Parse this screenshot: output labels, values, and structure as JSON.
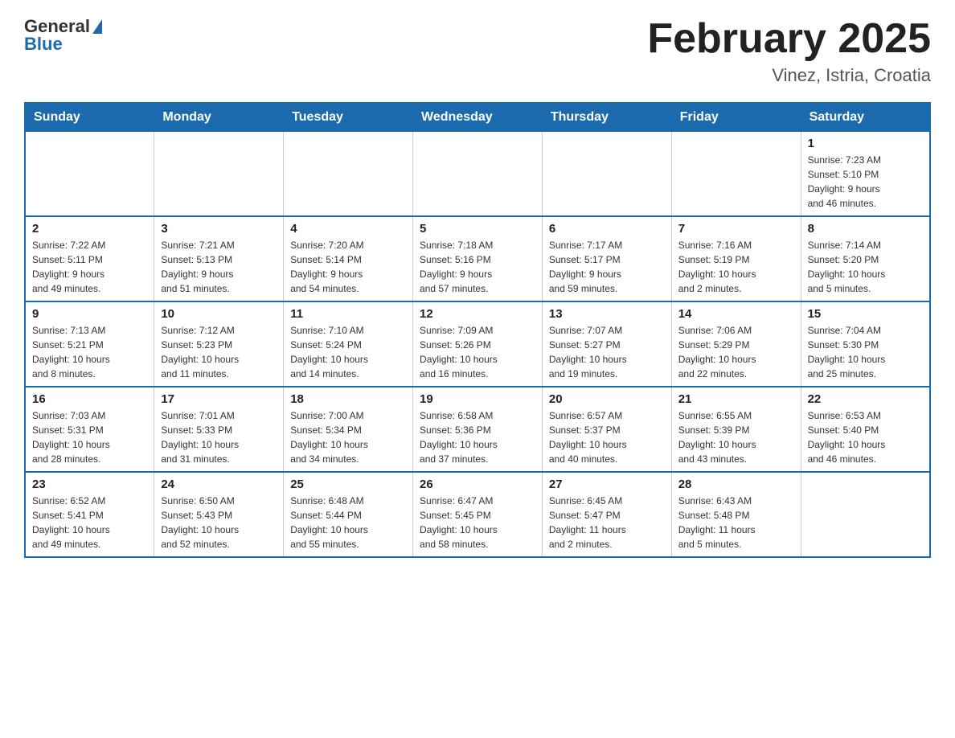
{
  "logo": {
    "general": "General",
    "blue": "Blue"
  },
  "header": {
    "month": "February 2025",
    "location": "Vinez, Istria, Croatia"
  },
  "days_of_week": [
    "Sunday",
    "Monday",
    "Tuesday",
    "Wednesday",
    "Thursday",
    "Friday",
    "Saturday"
  ],
  "weeks": [
    [
      {
        "day": "",
        "info": ""
      },
      {
        "day": "",
        "info": ""
      },
      {
        "day": "",
        "info": ""
      },
      {
        "day": "",
        "info": ""
      },
      {
        "day": "",
        "info": ""
      },
      {
        "day": "",
        "info": ""
      },
      {
        "day": "1",
        "info": "Sunrise: 7:23 AM\nSunset: 5:10 PM\nDaylight: 9 hours\nand 46 minutes."
      }
    ],
    [
      {
        "day": "2",
        "info": "Sunrise: 7:22 AM\nSunset: 5:11 PM\nDaylight: 9 hours\nand 49 minutes."
      },
      {
        "day": "3",
        "info": "Sunrise: 7:21 AM\nSunset: 5:13 PM\nDaylight: 9 hours\nand 51 minutes."
      },
      {
        "day": "4",
        "info": "Sunrise: 7:20 AM\nSunset: 5:14 PM\nDaylight: 9 hours\nand 54 minutes."
      },
      {
        "day": "5",
        "info": "Sunrise: 7:18 AM\nSunset: 5:16 PM\nDaylight: 9 hours\nand 57 minutes."
      },
      {
        "day": "6",
        "info": "Sunrise: 7:17 AM\nSunset: 5:17 PM\nDaylight: 9 hours\nand 59 minutes."
      },
      {
        "day": "7",
        "info": "Sunrise: 7:16 AM\nSunset: 5:19 PM\nDaylight: 10 hours\nand 2 minutes."
      },
      {
        "day": "8",
        "info": "Sunrise: 7:14 AM\nSunset: 5:20 PM\nDaylight: 10 hours\nand 5 minutes."
      }
    ],
    [
      {
        "day": "9",
        "info": "Sunrise: 7:13 AM\nSunset: 5:21 PM\nDaylight: 10 hours\nand 8 minutes."
      },
      {
        "day": "10",
        "info": "Sunrise: 7:12 AM\nSunset: 5:23 PM\nDaylight: 10 hours\nand 11 minutes."
      },
      {
        "day": "11",
        "info": "Sunrise: 7:10 AM\nSunset: 5:24 PM\nDaylight: 10 hours\nand 14 minutes."
      },
      {
        "day": "12",
        "info": "Sunrise: 7:09 AM\nSunset: 5:26 PM\nDaylight: 10 hours\nand 16 minutes."
      },
      {
        "day": "13",
        "info": "Sunrise: 7:07 AM\nSunset: 5:27 PM\nDaylight: 10 hours\nand 19 minutes."
      },
      {
        "day": "14",
        "info": "Sunrise: 7:06 AM\nSunset: 5:29 PM\nDaylight: 10 hours\nand 22 minutes."
      },
      {
        "day": "15",
        "info": "Sunrise: 7:04 AM\nSunset: 5:30 PM\nDaylight: 10 hours\nand 25 minutes."
      }
    ],
    [
      {
        "day": "16",
        "info": "Sunrise: 7:03 AM\nSunset: 5:31 PM\nDaylight: 10 hours\nand 28 minutes."
      },
      {
        "day": "17",
        "info": "Sunrise: 7:01 AM\nSunset: 5:33 PM\nDaylight: 10 hours\nand 31 minutes."
      },
      {
        "day": "18",
        "info": "Sunrise: 7:00 AM\nSunset: 5:34 PM\nDaylight: 10 hours\nand 34 minutes."
      },
      {
        "day": "19",
        "info": "Sunrise: 6:58 AM\nSunset: 5:36 PM\nDaylight: 10 hours\nand 37 minutes."
      },
      {
        "day": "20",
        "info": "Sunrise: 6:57 AM\nSunset: 5:37 PM\nDaylight: 10 hours\nand 40 minutes."
      },
      {
        "day": "21",
        "info": "Sunrise: 6:55 AM\nSunset: 5:39 PM\nDaylight: 10 hours\nand 43 minutes."
      },
      {
        "day": "22",
        "info": "Sunrise: 6:53 AM\nSunset: 5:40 PM\nDaylight: 10 hours\nand 46 minutes."
      }
    ],
    [
      {
        "day": "23",
        "info": "Sunrise: 6:52 AM\nSunset: 5:41 PM\nDaylight: 10 hours\nand 49 minutes."
      },
      {
        "day": "24",
        "info": "Sunrise: 6:50 AM\nSunset: 5:43 PM\nDaylight: 10 hours\nand 52 minutes."
      },
      {
        "day": "25",
        "info": "Sunrise: 6:48 AM\nSunset: 5:44 PM\nDaylight: 10 hours\nand 55 minutes."
      },
      {
        "day": "26",
        "info": "Sunrise: 6:47 AM\nSunset: 5:45 PM\nDaylight: 10 hours\nand 58 minutes."
      },
      {
        "day": "27",
        "info": "Sunrise: 6:45 AM\nSunset: 5:47 PM\nDaylight: 11 hours\nand 2 minutes."
      },
      {
        "day": "28",
        "info": "Sunrise: 6:43 AM\nSunset: 5:48 PM\nDaylight: 11 hours\nand 5 minutes."
      },
      {
        "day": "",
        "info": ""
      }
    ]
  ]
}
